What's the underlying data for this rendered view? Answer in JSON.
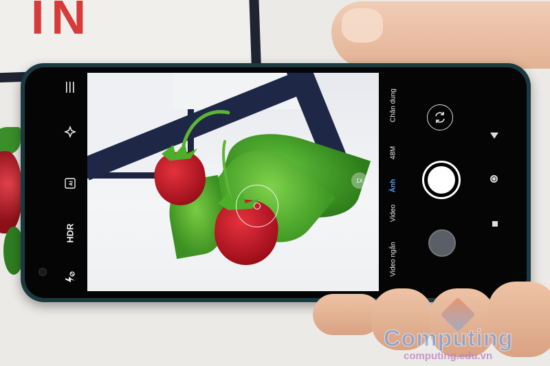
{
  "camera": {
    "left_controls": {
      "menu_icon": "menu-icon",
      "beauty_icon": "sparkle-icon",
      "ai_label": "AI",
      "hdr_label": "HDR",
      "flash_icon": "flash-off-icon"
    },
    "zoom_label": "1X",
    "modes": [
      {
        "label": "Video ngắn",
        "active": false
      },
      {
        "label": "Video",
        "active": false
      },
      {
        "label": "Ảnh",
        "active": true
      },
      {
        "label": "48M",
        "active": false
      },
      {
        "label": "Chân dung",
        "active": false
      }
    ],
    "accent_color": "#5aa0ff"
  },
  "watermark": {
    "brand": "Computing",
    "url": "computing.edu.vn"
  }
}
